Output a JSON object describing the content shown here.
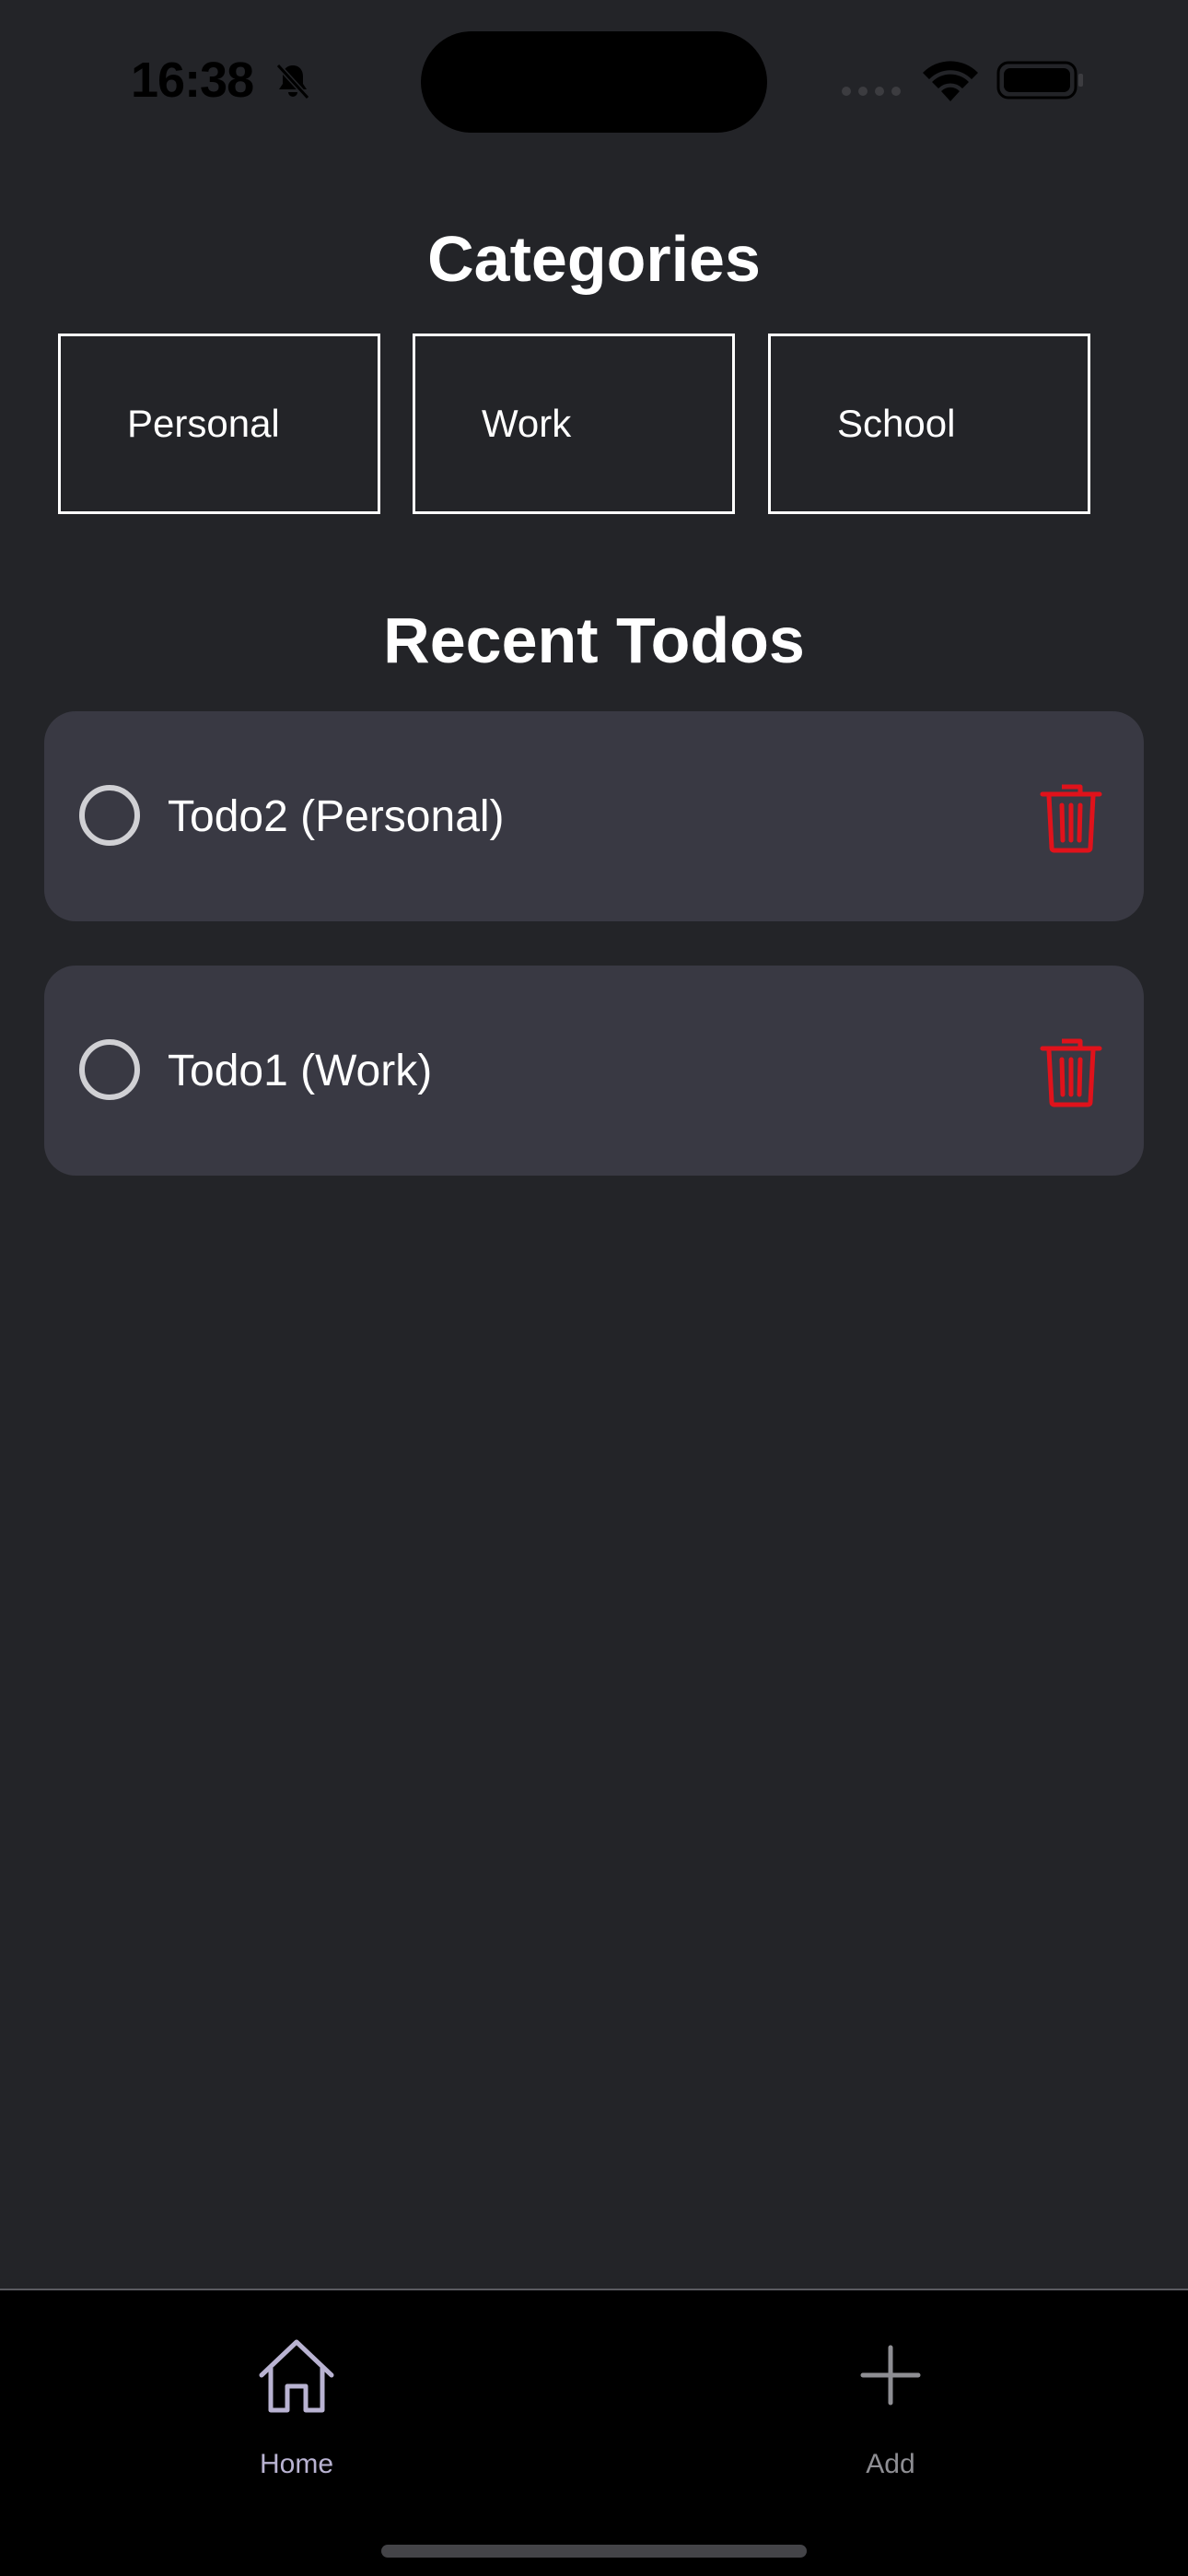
{
  "status_bar": {
    "time": "16:38",
    "icons": [
      "bell-slash-icon",
      "signal-icon",
      "wifi-icon",
      "battery-icon"
    ]
  },
  "categories": {
    "title": "Categories",
    "items": [
      {
        "label": "Personal"
      },
      {
        "label": "Work"
      },
      {
        "label": "School"
      }
    ]
  },
  "recent": {
    "title": "Recent Todos",
    "todos": [
      {
        "text": "Todo2 (Personal)",
        "done": false
      },
      {
        "text": "Todo1 (Work)",
        "done": false
      }
    ]
  },
  "tab_bar": {
    "tabs": [
      {
        "label": "Home",
        "icon": "home-icon",
        "active": true
      },
      {
        "label": "Add",
        "icon": "plus-icon",
        "active": false
      }
    ]
  },
  "colors": {
    "background": "#232428",
    "card": "#393943",
    "delete": "#e0121b",
    "tab_active": "#b9b3d2",
    "tab_inactive": "#8e8e93"
  }
}
